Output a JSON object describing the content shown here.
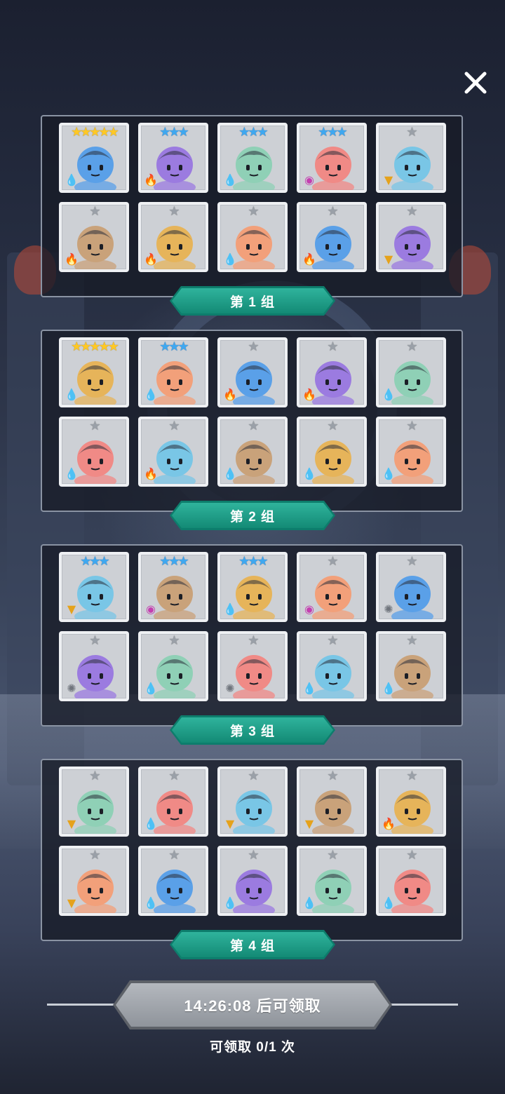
{
  "close_icon": "close-icon",
  "groups": [
    {
      "label": "第 1 组",
      "heroes": [
        {
          "stars": "★★★★★",
          "tier": "gold",
          "elem": "water"
        },
        {
          "stars": "★★★",
          "tier": "blue",
          "elem": "fire"
        },
        {
          "stars": "★★★",
          "tier": "blue",
          "elem": "water"
        },
        {
          "stars": "★★★",
          "tier": "blue",
          "elem": "dark"
        },
        {
          "stars": "★",
          "tier": "gray",
          "elem": "wind"
        },
        {
          "stars": "★",
          "tier": "gray",
          "elem": "fire"
        },
        {
          "stars": "★",
          "tier": "gray",
          "elem": "fire"
        },
        {
          "stars": "★",
          "tier": "gray",
          "elem": "water"
        },
        {
          "stars": "★",
          "tier": "gray",
          "elem": "fire"
        },
        {
          "stars": "★",
          "tier": "gray",
          "elem": "wind"
        }
      ]
    },
    {
      "label": "第 2 组",
      "heroes": [
        {
          "stars": "★★★★★",
          "tier": "gold",
          "elem": "water"
        },
        {
          "stars": "★★★",
          "tier": "blue",
          "elem": "water"
        },
        {
          "stars": "★",
          "tier": "gray",
          "elem": "fire"
        },
        {
          "stars": "★",
          "tier": "gray",
          "elem": "fire"
        },
        {
          "stars": "★",
          "tier": "gray",
          "elem": "water"
        },
        {
          "stars": "★",
          "tier": "gray",
          "elem": "water"
        },
        {
          "stars": "★",
          "tier": "gray",
          "elem": "fire"
        },
        {
          "stars": "★",
          "tier": "gray",
          "elem": "water"
        },
        {
          "stars": "★",
          "tier": "gray",
          "elem": "water"
        },
        {
          "stars": "★",
          "tier": "gray",
          "elem": "water"
        }
      ]
    },
    {
      "label": "第 3 组",
      "heroes": [
        {
          "stars": "★★★",
          "tier": "blue",
          "elem": "wind"
        },
        {
          "stars": "★★★",
          "tier": "blue",
          "elem": "dark"
        },
        {
          "stars": "★★★",
          "tier": "blue",
          "elem": "water"
        },
        {
          "stars": "★",
          "tier": "gray",
          "elem": "dark"
        },
        {
          "stars": "★",
          "tier": "gray",
          "elem": "light"
        },
        {
          "stars": "★",
          "tier": "gray",
          "elem": "light"
        },
        {
          "stars": "★",
          "tier": "gray",
          "elem": "water"
        },
        {
          "stars": "★",
          "tier": "gray",
          "elem": "light"
        },
        {
          "stars": "★",
          "tier": "gray",
          "elem": "water"
        },
        {
          "stars": "★",
          "tier": "gray",
          "elem": "water"
        }
      ]
    },
    {
      "label": "第 4 组",
      "heroes": [
        {
          "stars": "★",
          "tier": "gray",
          "elem": "wind"
        },
        {
          "stars": "★",
          "tier": "gray",
          "elem": "water"
        },
        {
          "stars": "★",
          "tier": "gray",
          "elem": "wind"
        },
        {
          "stars": "★",
          "tier": "gray",
          "elem": "wind"
        },
        {
          "stars": "★",
          "tier": "gray",
          "elem": "fire"
        },
        {
          "stars": "★",
          "tier": "gray",
          "elem": "wind"
        },
        {
          "stars": "★",
          "tier": "gray",
          "elem": "water"
        },
        {
          "stars": "★",
          "tier": "gray",
          "elem": "water"
        },
        {
          "stars": "★",
          "tier": "gray",
          "elem": "water"
        },
        {
          "stars": "★",
          "tier": "gray",
          "elem": "water"
        }
      ]
    }
  ],
  "claim": {
    "button_label": "14:26:08 后可领取",
    "count_text": "可领取 0/1 次"
  },
  "colors": {
    "banner": "#1aa58f",
    "panel_border": "#8a93a3",
    "card_bg": "#cdd0d5",
    "gold_star": "#ffc825",
    "blue_star": "#3fa8f0"
  }
}
